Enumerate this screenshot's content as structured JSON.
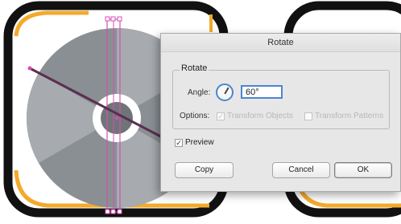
{
  "dialog": {
    "title": "Rotate",
    "group_title": "Rotate",
    "angle_label": "Angle:",
    "angle_value": "60°",
    "options_label": "Options:",
    "transform_objects_label": "Transform Objects",
    "transform_patterns_label": "Transform Patterns",
    "preview_label": "Preview",
    "preview_checked": true,
    "transform_objects_checked": true,
    "transform_patterns_checked": false,
    "buttons": {
      "copy": "Copy",
      "cancel": "Cancel",
      "ok": "OK"
    }
  },
  "colors": {
    "frame_orange": "#f3aa2b",
    "frame_black": "#111111",
    "disc_gray": "#8a8f94",
    "disc_light": "#b9bdc1",
    "selection_magenta": "#d84fb4",
    "rotation_line": "#5b2e4f",
    "focus_blue": "#4a86cf"
  }
}
